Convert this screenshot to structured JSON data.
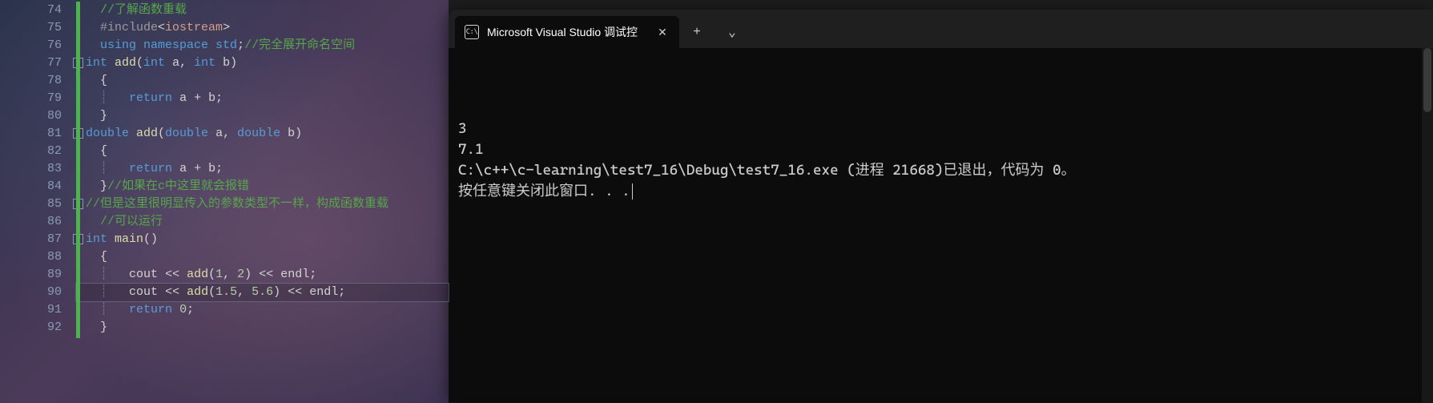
{
  "editor": {
    "first_line_number": 74,
    "current_line_number": 90,
    "lines": [
      {
        "fold": null,
        "tokens": [
          [
            "guide",
            "  "
          ],
          [
            "c-comment",
            "//了解函数重载"
          ]
        ]
      },
      {
        "fold": null,
        "tokens": [
          [
            "guide",
            "  "
          ],
          [
            "c-pp",
            "#include"
          ],
          [
            "c-punct",
            "<"
          ],
          [
            "c-str",
            "iostream"
          ],
          [
            "c-punct",
            ">"
          ]
        ]
      },
      {
        "fold": null,
        "tokens": [
          [
            "guide",
            "  "
          ],
          [
            "c-keyword",
            "using "
          ],
          [
            "c-keyword",
            "namespace "
          ],
          [
            "c-type",
            "std"
          ],
          [
            "c-punct",
            ";"
          ],
          [
            "c-comment",
            "//完全展开命名空间"
          ]
        ]
      },
      {
        "fold": "-",
        "tokens": [
          [
            "c-type",
            "int "
          ],
          [
            "c-func",
            "add"
          ],
          [
            "c-punct",
            "("
          ],
          [
            "c-type",
            "int "
          ],
          [
            "",
            "a"
          ],
          [
            "c-punct",
            ", "
          ],
          [
            "c-type",
            "int "
          ],
          [
            "",
            "b"
          ],
          [
            "c-punct",
            ")"
          ]
        ]
      },
      {
        "fold": null,
        "tokens": [
          [
            "guide",
            "  "
          ],
          [
            "c-brace",
            "{"
          ]
        ]
      },
      {
        "fold": null,
        "tokens": [
          [
            "guide",
            "  ┊   "
          ],
          [
            "c-keyword",
            "return "
          ],
          [
            "",
            "a "
          ],
          [
            "c-op",
            "+"
          ],
          [
            "",
            " b"
          ],
          [
            "c-punct",
            ";"
          ]
        ]
      },
      {
        "fold": null,
        "tokens": [
          [
            "guide",
            "  "
          ],
          [
            "c-brace",
            "}"
          ]
        ]
      },
      {
        "fold": "-",
        "tokens": [
          [
            "c-type",
            "double "
          ],
          [
            "c-func",
            "add"
          ],
          [
            "c-punct",
            "("
          ],
          [
            "c-type",
            "double "
          ],
          [
            "",
            "a"
          ],
          [
            "c-punct",
            ", "
          ],
          [
            "c-type",
            "double "
          ],
          [
            "",
            "b"
          ],
          [
            "c-punct",
            ")"
          ]
        ]
      },
      {
        "fold": null,
        "tokens": [
          [
            "guide",
            "  "
          ],
          [
            "c-brace",
            "{"
          ]
        ]
      },
      {
        "fold": null,
        "tokens": [
          [
            "guide",
            "  ┊   "
          ],
          [
            "c-keyword",
            "return "
          ],
          [
            "",
            "a "
          ],
          [
            "c-op",
            "+"
          ],
          [
            "",
            " b"
          ],
          [
            "c-punct",
            ";"
          ]
        ]
      },
      {
        "fold": null,
        "tokens": [
          [
            "guide",
            "  "
          ],
          [
            "c-brace",
            "}"
          ],
          [
            "c-comment",
            "//如果在c中这里就会报错"
          ]
        ]
      },
      {
        "fold": "-",
        "tokens": [
          [
            "c-comment",
            "//但是这里很明显传入的参数类型不一样，构成函数重载"
          ]
        ]
      },
      {
        "fold": null,
        "tokens": [
          [
            "guide",
            "  "
          ],
          [
            "c-comment",
            "//可以运行"
          ]
        ]
      },
      {
        "fold": "-",
        "tokens": [
          [
            "c-type",
            "int "
          ],
          [
            "c-func",
            "main"
          ],
          [
            "c-punct",
            "()"
          ]
        ]
      },
      {
        "fold": null,
        "tokens": [
          [
            "guide",
            "  "
          ],
          [
            "c-brace",
            "{"
          ]
        ]
      },
      {
        "fold": null,
        "tokens": [
          [
            "guide",
            "  ┊   "
          ],
          [
            "",
            "cout "
          ],
          [
            "c-op",
            "<<"
          ],
          [
            "",
            " "
          ],
          [
            "c-func",
            "add"
          ],
          [
            "c-punct",
            "("
          ],
          [
            "c-num",
            "1"
          ],
          [
            "c-punct",
            ", "
          ],
          [
            "c-num",
            "2"
          ],
          [
            "c-punct",
            ") "
          ],
          [
            "c-op",
            "<<"
          ],
          [
            "",
            " endl"
          ],
          [
            "c-punct",
            ";"
          ]
        ]
      },
      {
        "fold": null,
        "tokens": [
          [
            "guide",
            "  ┊   "
          ],
          [
            "",
            "cout "
          ],
          [
            "c-op",
            "<<"
          ],
          [
            "",
            " "
          ],
          [
            "c-func",
            "add"
          ],
          [
            "c-punct",
            "("
          ],
          [
            "c-num",
            "1.5"
          ],
          [
            "c-punct",
            ", "
          ],
          [
            "c-num",
            "5.6"
          ],
          [
            "c-punct",
            ") "
          ],
          [
            "c-op",
            "<<"
          ],
          [
            "",
            " endl"
          ],
          [
            "c-punct",
            ";"
          ]
        ]
      },
      {
        "fold": null,
        "tokens": [
          [
            "guide",
            "  ┊   "
          ],
          [
            "c-keyword",
            "return "
          ],
          [
            "c-num",
            "0"
          ],
          [
            "c-punct",
            ";"
          ]
        ]
      },
      {
        "fold": null,
        "tokens": [
          [
            "guide",
            "  "
          ],
          [
            "c-brace",
            "}"
          ]
        ]
      }
    ]
  },
  "terminal": {
    "tab_title": "Microsoft Visual Studio 调试控",
    "tab_icon_text": "C:\\",
    "new_tab_glyph": "+",
    "dropdown_glyph": "⌄",
    "close_glyph": "✕",
    "output_lines": [
      "3",
      "7.1",
      "",
      "C:\\c++\\c-learning\\test7_16\\Debug\\test7_16.exe (进程 21668)已退出，代码为 0。",
      "按任意键关闭此窗口. . ."
    ]
  }
}
